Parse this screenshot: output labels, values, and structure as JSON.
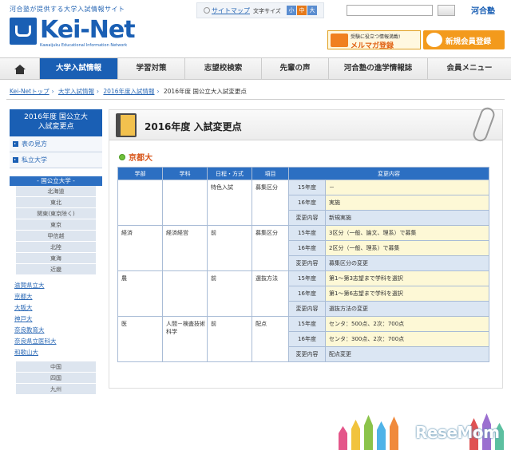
{
  "header": {
    "tagline": "河合塾が提供する大学入試情報サイト",
    "logo_text": "Kei-Net",
    "logo_sub": "Kawaijuku Educational Information Network",
    "sitemap": "サイトマップ",
    "font_size_label": "文字サイズ",
    "font_sizes": [
      "小",
      "中",
      "大"
    ],
    "brand": "河合塾",
    "banner_mailmag_small": "受験に役立つ情報満載!",
    "banner_mailmag": "メルマガ登録",
    "banner_register": "新規会員登録"
  },
  "nav": {
    "items": [
      "大学入試情報",
      "学習対策",
      "志望校検索",
      "先輩の声",
      "河合塾の進学情報誌",
      "会員メニュー"
    ]
  },
  "breadcrumb": [
    "Kei-Netトップ",
    "大学入試情報",
    "2016年度入試情報",
    "2016年度 国公立大入試変更点"
  ],
  "sidebar": {
    "title_line1": "2016年度 国公立大",
    "title_line2": "入試変更点",
    "links": [
      "表の見方",
      "私立大学"
    ],
    "section": "- 国公立大学 -",
    "regions_top": [
      "北海道",
      "東北",
      "関東(東京除く)",
      "東京",
      "甲信越",
      "北陸",
      "東海",
      "近畿"
    ],
    "universities": [
      "滋賀県立大",
      "京都大",
      "大阪大",
      "神戸大",
      "奈良教育大",
      "奈良県立医科大",
      "和歌山大"
    ],
    "regions_bottom": [
      "中国",
      "四国",
      "九州"
    ]
  },
  "main": {
    "title": "2016年度 入試変更点",
    "university": "京都大",
    "headers": [
      "学部",
      "学科",
      "日程・方式",
      "項目",
      "変更内容"
    ],
    "groups": [
      {
        "faculty": "",
        "department": "",
        "schedule": "特色入試",
        "item": "募集区分",
        "rows": [
          [
            "15年度",
            "－"
          ],
          [
            "16年度",
            "実施"
          ],
          [
            "変更内容",
            "新規実施"
          ]
        ]
      },
      {
        "faculty": "経済",
        "department": "経済経営",
        "schedule": "前",
        "item": "募集区分",
        "rows": [
          [
            "15年度",
            "3区分（一般、論文、理系）で募集"
          ],
          [
            "16年度",
            "2区分（一般、理系）で募集"
          ],
          [
            "変更内容",
            "募集区分の変更"
          ]
        ]
      },
      {
        "faculty": "農",
        "department": "",
        "schedule": "前",
        "item": "選抜方法",
        "rows": [
          [
            "15年度",
            "第1～第3志望まで学科を選択"
          ],
          [
            "16年度",
            "第1～第6志望まで学科を選択"
          ],
          [
            "変更内容",
            "選抜方法の変更"
          ]
        ]
      },
      {
        "faculty": "医",
        "department": "人間－検査技術科学",
        "schedule": "前",
        "item": "配点",
        "rows": [
          [
            "15年度",
            "センタ：500点、2次：700点"
          ],
          [
            "16年度",
            "センタ：300点、2次：700点"
          ],
          [
            "変更内容",
            "配点変更"
          ]
        ]
      }
    ]
  },
  "watermark": "ReseMom",
  "colors": {
    "primary": "#1a5fb4",
    "accent": "#e57a1b",
    "header_cell": "#2c6fc2",
    "value_cell": "#fdf8d6",
    "label_cell": "#dbe6f3"
  }
}
